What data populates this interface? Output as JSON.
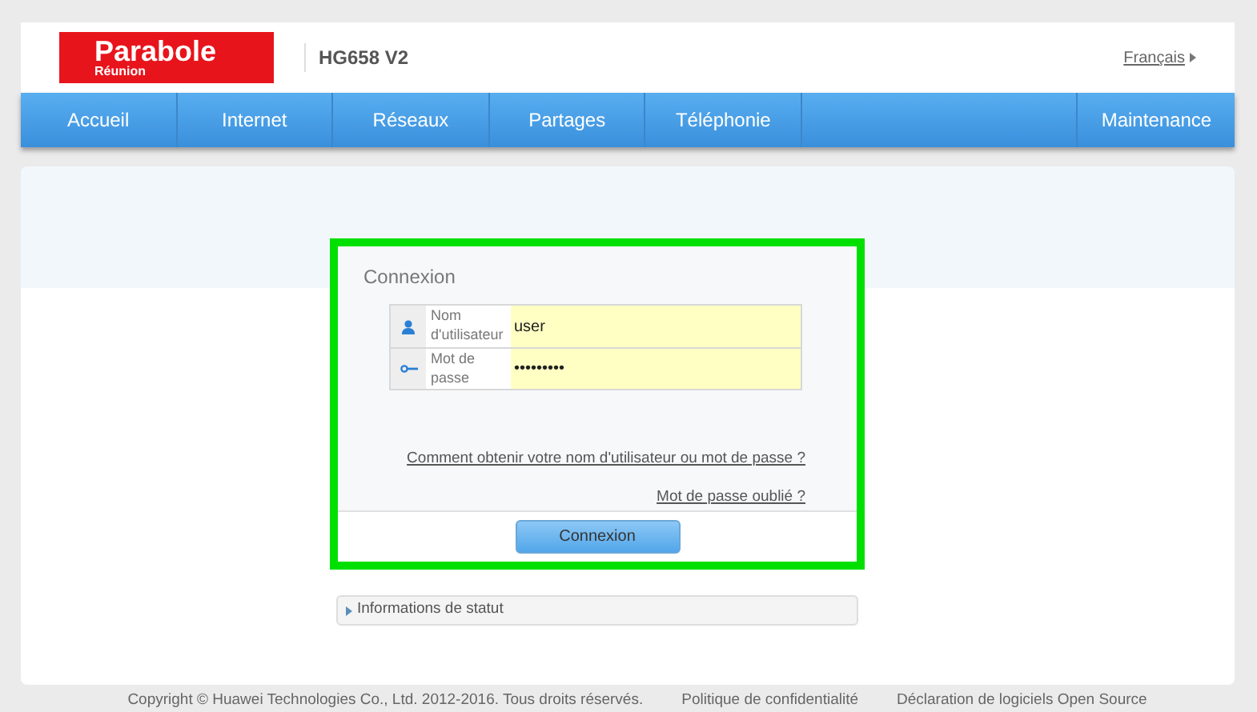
{
  "header": {
    "brand": "Parabole",
    "brand_sub": "Réunion",
    "model": "HG658 V2",
    "language": "Français"
  },
  "nav": [
    {
      "label": "Accueil",
      "kind": "item"
    },
    {
      "label": "Internet",
      "kind": "item"
    },
    {
      "label": "Réseaux",
      "kind": "item"
    },
    {
      "label": "Partages",
      "kind": "item"
    },
    {
      "label": "Téléphonie",
      "kind": "item"
    },
    {
      "kind": "spacer"
    },
    {
      "label": "Maintenance",
      "kind": "item"
    }
  ],
  "login": {
    "title": "Connexion",
    "highlighted": true,
    "fields": [
      {
        "kind": "user",
        "label": "Nom d'utilisateur",
        "value": "user"
      },
      {
        "kind": "password",
        "label": "Mot de passe",
        "value": "•••••••••"
      }
    ],
    "links": [
      "Comment obtenir votre nom d'utilisateur ou mot de passe ?",
      "Mot de passe oublié ?"
    ],
    "button": "Connexion"
  },
  "status_panel": {
    "label": "Informations de statut",
    "expanded": false
  },
  "footer": [
    "Copyright © Huawei Technologies Co., Ltd. 2012-2016. Tous droits réservés.",
    "Politique de confidentialité",
    "Déclaration de logiciels Open Source"
  ]
}
